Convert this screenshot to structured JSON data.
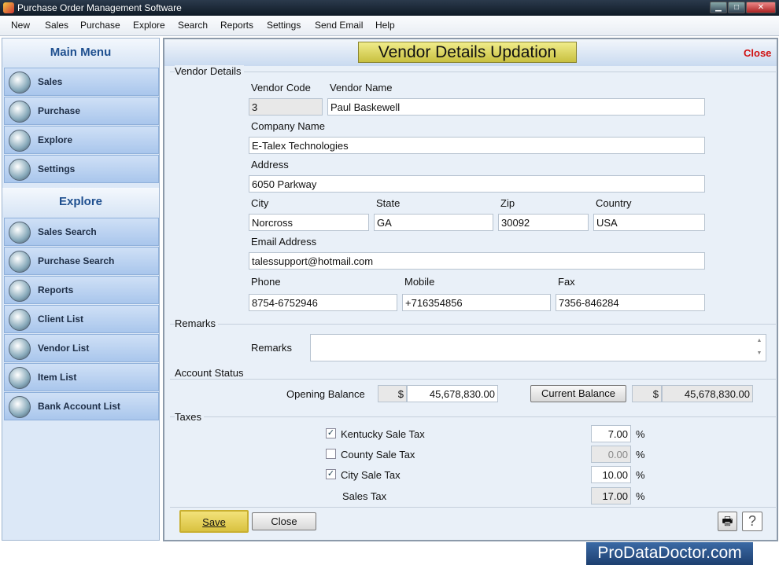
{
  "window": {
    "title": "Purchase Order Management Software"
  },
  "menu": [
    "New",
    "Sales",
    "Purchase",
    "Explore",
    "Search",
    "Reports",
    "Settings",
    "Send Email",
    "Help"
  ],
  "sidebar": {
    "main_title": "Main Menu",
    "main_items": [
      {
        "label": "Sales",
        "icon": "sales-chart-icon"
      },
      {
        "label": "Purchase",
        "icon": "purchase-basket-icon"
      },
      {
        "label": "Explore",
        "icon": "explore-icon"
      },
      {
        "label": "Settings",
        "icon": "gear-icon"
      }
    ],
    "explore_title": "Explore",
    "explore_items": [
      {
        "label": "Sales Search",
        "icon": "sales-search-icon"
      },
      {
        "label": "Purchase Search",
        "icon": "purchase-search-icon"
      },
      {
        "label": "Reports",
        "icon": "reports-icon"
      },
      {
        "label": "Client List",
        "icon": "client-icon"
      },
      {
        "label": "Vendor List",
        "icon": "vendor-icon"
      },
      {
        "label": "Item List",
        "icon": "item-icon"
      },
      {
        "label": "Bank Account List",
        "icon": "bank-icon"
      }
    ]
  },
  "page": {
    "title": "Vendor Details Updation",
    "close": "Close"
  },
  "vendor": {
    "group": "Vendor Details",
    "code_label": "Vendor Code",
    "code": "3",
    "name_label": "Vendor Name",
    "name": "Paul Baskewell",
    "company_label": "Company Name",
    "company": "E-Talex Technologies",
    "address_label": "Address",
    "address": "6050 Parkway",
    "city_label": "City",
    "city": "Norcross",
    "state_label": "State",
    "state": "GA",
    "zip_label": "Zip",
    "zip": "30092",
    "country_label": "Country",
    "country": "USA",
    "email_label": "Email Address",
    "email": "talessupport@hotmail.com",
    "phone_label": "Phone",
    "phone": "8754-6752946",
    "mobile_label": "Mobile",
    "mobile": "+716354856",
    "fax_label": "Fax",
    "fax": "7356-846284"
  },
  "remarks": {
    "group": "Remarks",
    "label": "Remarks",
    "value": ""
  },
  "account": {
    "group": "Account Status",
    "opening_label": "Opening Balance",
    "currency": "$",
    "opening": "45,678,830.00",
    "current_button": "Current Balance",
    "current": "45,678,830.00"
  },
  "taxes": {
    "group": "Taxes",
    "percent": "%",
    "items": [
      {
        "label": "Kentucky Sale Tax",
        "checked": true,
        "value": "7.00"
      },
      {
        "label": "County Sale Tax",
        "checked": false,
        "value": "0.00"
      },
      {
        "label": "City Sale Tax",
        "checked": true,
        "value": "10.00"
      }
    ],
    "total_label": "Sales Tax",
    "total": "17.00"
  },
  "buttons": {
    "save": "Save",
    "close": "Close"
  },
  "watermark": "ProDataDoctor.com"
}
